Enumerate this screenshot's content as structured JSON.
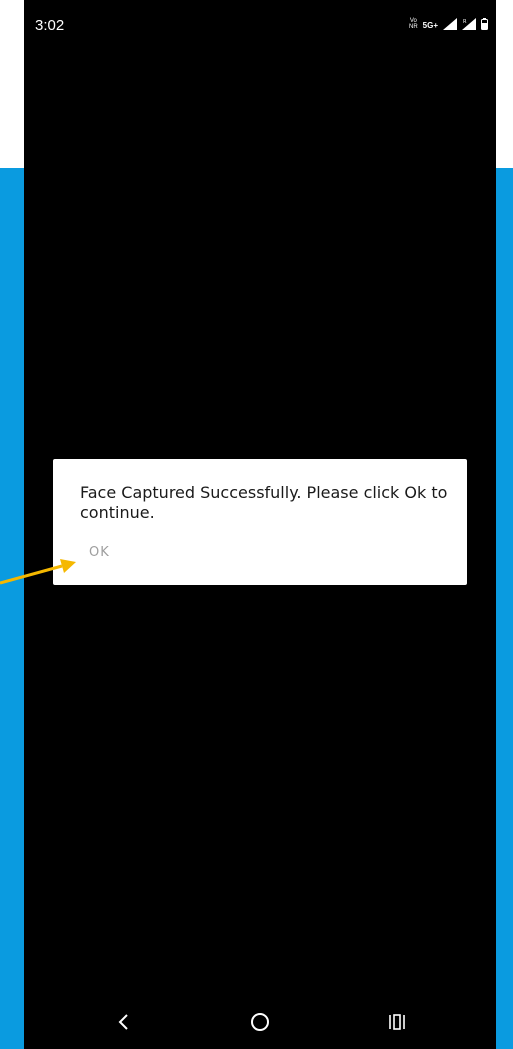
{
  "status_bar": {
    "time": "3:02",
    "volte_top": "Vo",
    "volte_bottom": "NR",
    "network": "5G+"
  },
  "dialog": {
    "message": "Face Captured Successfully. Please click Ok to continue.",
    "ok_label": "OK"
  },
  "colors": {
    "background_blue": "#0a9be0",
    "dialog_bg": "#ffffff",
    "ok_text": "#9e9e9e",
    "annotation_arrow": "#f5b800"
  },
  "icons": {
    "nav_back": "chevron-left-icon",
    "nav_home": "circle-home-icon",
    "nav_recents": "recents-icon"
  }
}
